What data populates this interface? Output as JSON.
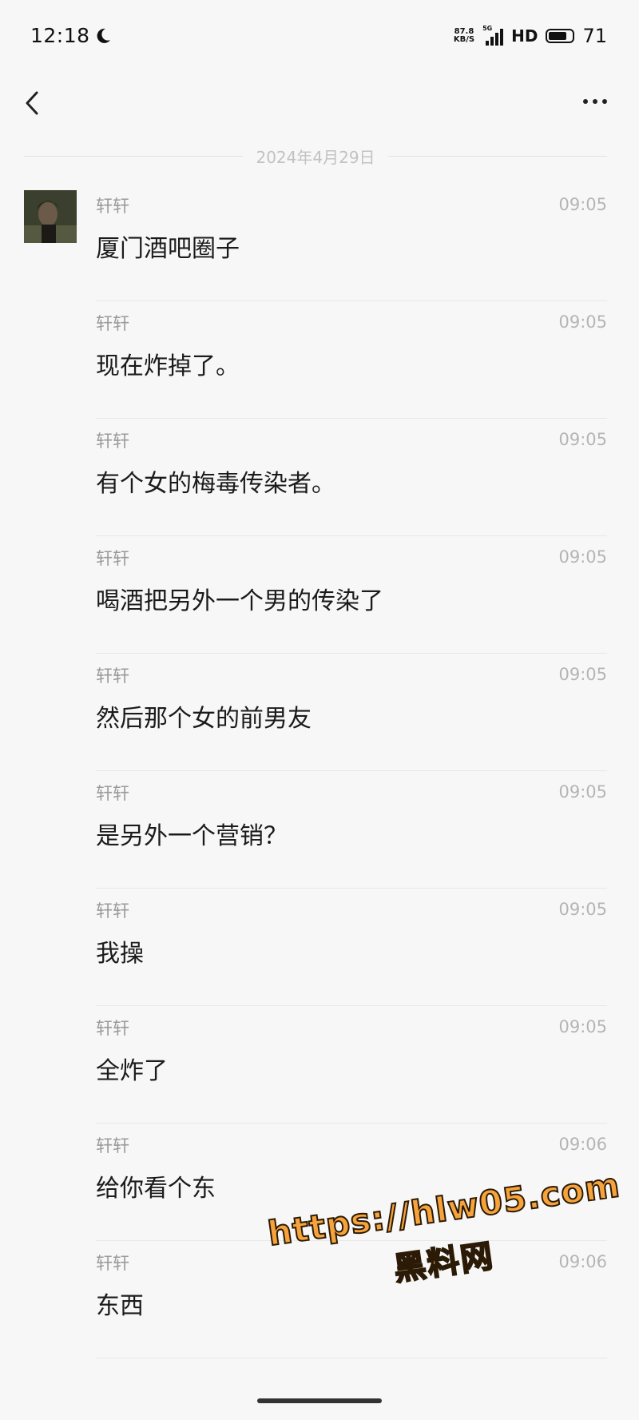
{
  "status_bar": {
    "time": "12:18",
    "net_speed_value": "87.8",
    "net_speed_unit": "KB/S",
    "signal_label": "5G",
    "hd_label": "HD",
    "battery_level": "71"
  },
  "date_separator": "2024年4月29日",
  "messages": [
    {
      "sender": "轩轩",
      "time": "09:05",
      "text": "厦门酒吧圈子"
    },
    {
      "sender": "轩轩",
      "time": "09:05",
      "text": "现在炸掉了。"
    },
    {
      "sender": "轩轩",
      "time": "09:05",
      "text": "有个女的梅毒传染者。"
    },
    {
      "sender": "轩轩",
      "time": "09:05",
      "text": "喝酒把另外一个男的传染了"
    },
    {
      "sender": "轩轩",
      "time": "09:05",
      "text": "然后那个女的前男友"
    },
    {
      "sender": "轩轩",
      "time": "09:05",
      "text": "是另外一个营销？"
    },
    {
      "sender": "轩轩",
      "time": "09:05",
      "text": "我操"
    },
    {
      "sender": "轩轩",
      "time": "09:05",
      "text": "全炸了"
    },
    {
      "sender": "轩轩",
      "time": "09:06",
      "text": "给你看个东"
    },
    {
      "sender": "轩轩",
      "time": "09:06",
      "text": "东西"
    }
  ],
  "watermark": {
    "url": "https://hlw05.com",
    "name": "黑料网"
  }
}
